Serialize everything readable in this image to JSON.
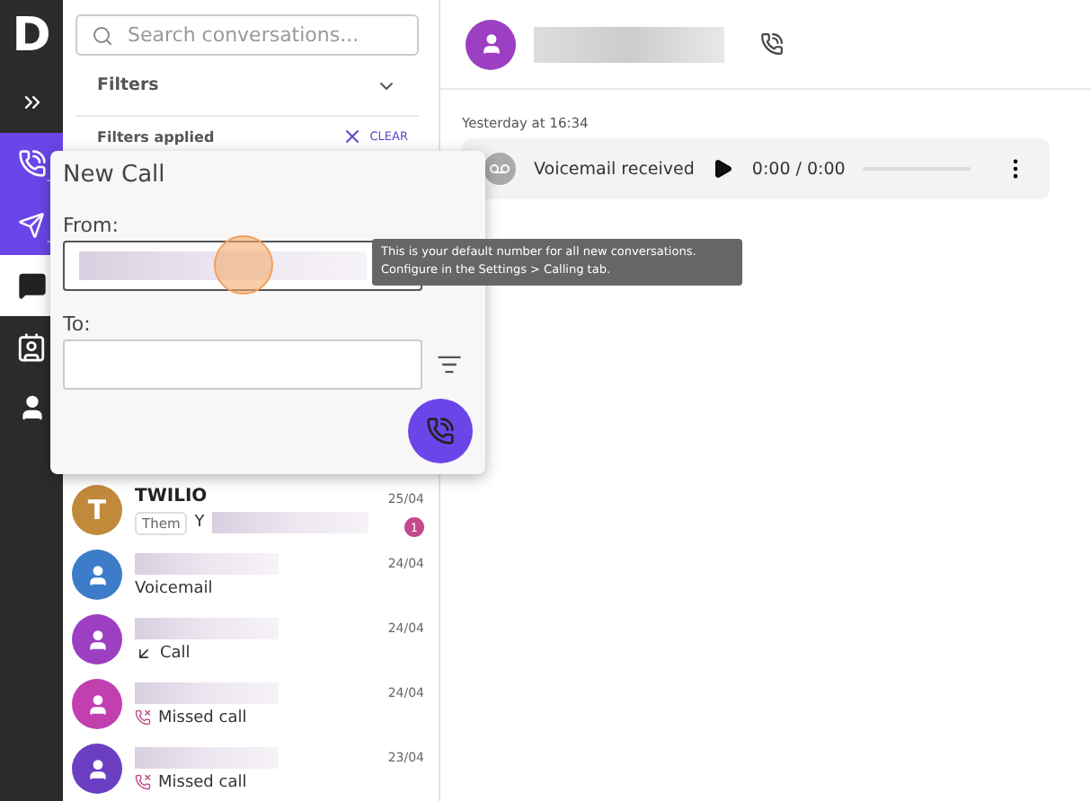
{
  "rail": {
    "logo": "D",
    "items": [
      {
        "kind": "new-call",
        "selected": false
      },
      {
        "kind": "new-message",
        "selected": false
      },
      {
        "kind": "chats",
        "selected": true
      },
      {
        "kind": "contacts",
        "selected": false
      },
      {
        "kind": "voice",
        "selected": false
      }
    ]
  },
  "sidebar": {
    "search": {
      "placeholder": "Search conversations..."
    },
    "filters_label": "Filters",
    "filters_applied": "Filters applied",
    "clear": "CLEAR",
    "conversations": [
      {
        "kind": "message",
        "name": "TWILIO",
        "initial": "T",
        "color": "#c08a3a",
        "date": "25/04",
        "tag": "Them",
        "preview": "Y",
        "unread": "1"
      },
      {
        "kind": "voicemail",
        "color": "#3d7cc9",
        "date": "24/04",
        "preview": "Voicemail"
      },
      {
        "kind": "call",
        "color": "#9c3fc2",
        "date": "24/04",
        "preview": "Call"
      },
      {
        "kind": "missed",
        "color": "#c23fb0",
        "date": "24/04",
        "preview": "Missed call"
      },
      {
        "kind": "missed",
        "color": "#6a3fc2",
        "date": "23/04",
        "preview": "Missed call"
      }
    ]
  },
  "main": {
    "day": "Yesterday at 16:34",
    "voicemail": {
      "label": "Voicemail received",
      "time": "0:00 / 0:00"
    }
  },
  "dialog": {
    "title": "New Call",
    "from_label": "From:",
    "to_label": "To:",
    "tooltip": [
      "This is your default number for all new conversations.",
      "Configure in the Settings > Calling tab."
    ]
  }
}
